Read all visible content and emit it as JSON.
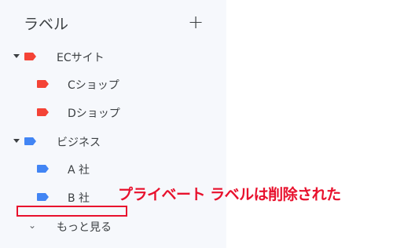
{
  "sidebar": {
    "title": "ラベル",
    "add_icon": "+",
    "items": [
      {
        "label": "ECサイト",
        "color": "#f44336",
        "expanded": true
      },
      {
        "label": "Cショップ",
        "color": "#f44336"
      },
      {
        "label": "Dショップ",
        "color": "#f44336"
      },
      {
        "label": "ビジネス",
        "color": "#4285f4",
        "expanded": true
      },
      {
        "label": "A 社",
        "color": "#4285f4"
      },
      {
        "label": "B 社",
        "color": "#4285f4"
      }
    ],
    "more_label": "もっと見る",
    "more_icon": "⌄"
  },
  "annotation": {
    "text": "プライベート ラベルは削除された",
    "color": "#e8112d"
  }
}
